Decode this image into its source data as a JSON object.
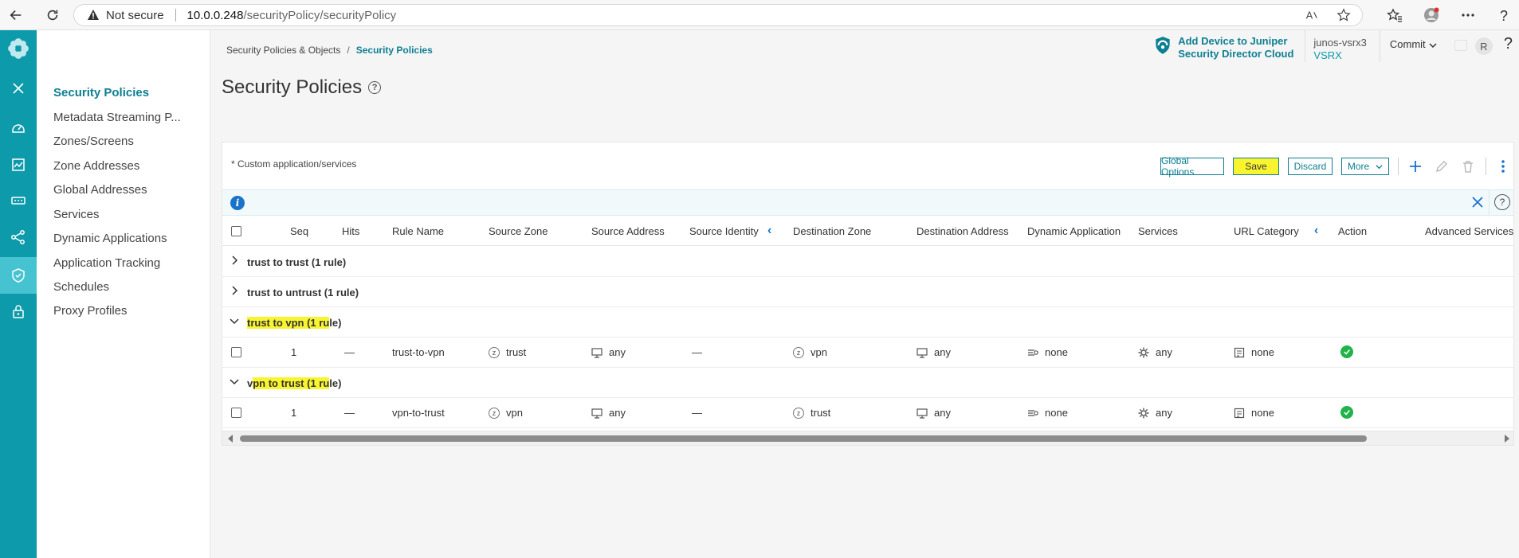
{
  "browser": {
    "security_label": "Not secure",
    "url_host": "10.0.0.248",
    "url_path": "/securityPolicy/securityPolicy"
  },
  "colors": {
    "brand": "#0d9aaa",
    "accent": "#0d7f92",
    "highlight": "#f8f530",
    "success": "#20b34a"
  },
  "rail": {
    "items": [
      "logo-icon",
      "close-icon",
      "dashboard-icon",
      "monitor-icon",
      "device-icon",
      "network-icon",
      "security-policy-icon",
      "lock-icon"
    ],
    "active": "security-policy-icon"
  },
  "subnav": {
    "items": [
      {
        "label": "Security Policies",
        "active": true
      },
      {
        "label": "Metadata Streaming P..."
      },
      {
        "label": "Zones/Screens"
      },
      {
        "label": "Zone Addresses"
      },
      {
        "label": "Global Addresses"
      },
      {
        "label": "Services"
      },
      {
        "label": "Dynamic Applications"
      },
      {
        "label": "Application Tracking"
      },
      {
        "label": "Schedules"
      },
      {
        "label": "Proxy Profiles"
      }
    ]
  },
  "breadcrumb": {
    "parent": "Security Policies & Objects",
    "separator": "/",
    "current": "Security Policies"
  },
  "header": {
    "cloud_line1": "Add Device to Juniper",
    "cloud_line2": "Security Director Cloud",
    "device_name": "junos-vsrx3",
    "device_type": "VSRX",
    "commit_label": "Commit",
    "avatar_letter": "R",
    "help": "?"
  },
  "page": {
    "title": "Security Policies",
    "note": "* Custom application/services"
  },
  "toolbar": {
    "global_options": "Global Options",
    "save": "Save",
    "discard": "Discard",
    "more": "More"
  },
  "table": {
    "columns": {
      "seq": "Seq",
      "hits": "Hits",
      "rule_name": "Rule Name",
      "source_zone": "Source Zone",
      "source_address": "Source Address",
      "source_identity": "Source Identity",
      "destination_zone": "Destination Zone",
      "destination_address": "Destination Address",
      "dynamic_application": "Dynamic Application",
      "services": "Services",
      "url_category": "URL Category",
      "action": "Action",
      "advanced_services": "Advanced Services"
    },
    "groups": [
      {
        "label": "trust to trust (1 rule)",
        "expanded": false
      },
      {
        "label": "trust to untrust (1 rule)",
        "expanded": false
      },
      {
        "label": "trust to vpn (1 rule)",
        "expanded": true,
        "hl": "trust to vpn (1 ru",
        "rest": "le)"
      },
      {
        "label": "vpn to trust (1 rule)",
        "expanded": true,
        "pre": "v",
        "hl": "pn to trust (1 ru",
        "rest": "le)"
      }
    ],
    "rows": [
      {
        "seq": "1",
        "hits": "—",
        "rule_name": "trust-to-vpn",
        "source_zone": "trust",
        "source_address": "any",
        "source_identity": "—",
        "destination_zone": "vpn",
        "destination_address": "any",
        "dynamic_application": "none",
        "services": "any",
        "url_category": "none"
      },
      {
        "seq": "1",
        "hits": "—",
        "rule_name": "vpn-to-trust",
        "source_zone": "vpn",
        "source_address": "any",
        "source_identity": "—",
        "destination_zone": "trust",
        "destination_address": "any",
        "dynamic_application": "none",
        "services": "any",
        "url_category": "none"
      }
    ]
  }
}
